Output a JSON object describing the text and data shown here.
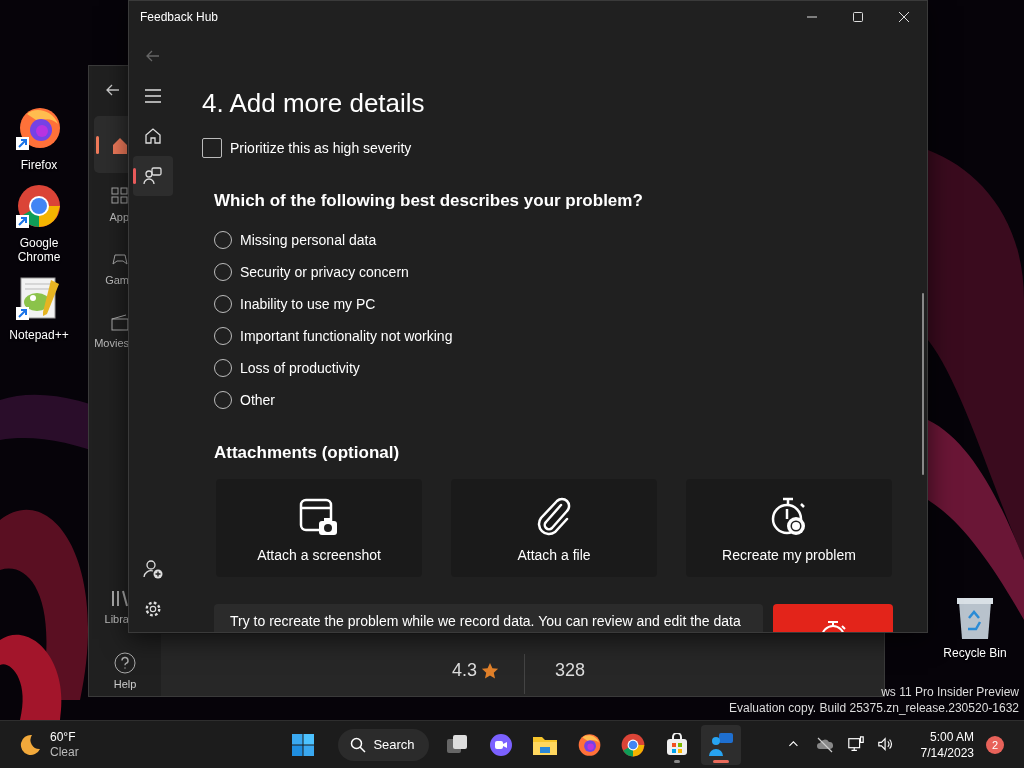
{
  "desktop_icons": [
    {
      "kind": "firefox",
      "label": "Firefox"
    },
    {
      "kind": "chrome",
      "label": "Google Chrome"
    },
    {
      "kind": "notepad",
      "label": "Notepad++"
    }
  ],
  "recycle_bin": {
    "label": "Recycle Bin"
  },
  "store_window": {
    "nav": [
      {
        "kind": "home",
        "selected": true
      },
      {
        "kind": "apps",
        "label": "App",
        "selected": false
      },
      {
        "kind": "games",
        "label": "Gam",
        "selected": false
      },
      {
        "kind": "movies",
        "label": "Movies",
        "selected": false
      },
      {
        "kind": "library",
        "label": "Libra",
        "selected": false
      }
    ],
    "help": {
      "label": "Help"
    },
    "rating": "4.3",
    "ratings_count": "328"
  },
  "feedback_window": {
    "title": "Feedback Hub",
    "nav": [
      {
        "kind": "home",
        "selected": false
      },
      {
        "kind": "feedback",
        "selected": true
      }
    ],
    "heading": "4. Add more details",
    "severity": {
      "label": "Prioritize this as high severity",
      "checked": false
    },
    "question": "Which of the following best describes your problem?",
    "options": [
      {
        "label": "Missing personal data",
        "selected": false
      },
      {
        "label": "Security or privacy concern",
        "selected": false
      },
      {
        "label": "Inability to use my PC",
        "selected": false
      },
      {
        "label": "Important functionality not working",
        "selected": false
      },
      {
        "label": "Loss of productivity",
        "selected": false
      },
      {
        "label": "Other",
        "selected": false
      }
    ],
    "attachments_heading": "Attachments (optional)",
    "attachments": [
      {
        "kind": "screenshot",
        "label": "Attach a screenshot"
      },
      {
        "kind": "file",
        "label": "Attach a file"
      },
      {
        "kind": "recreate",
        "label": "Recreate my problem"
      }
    ],
    "recreate_hint": "Try to recreate the problem while we record data. You can review and edit the data"
  },
  "watermark": [
    "ws 11 Pro Insider Preview",
    "Evaluation copy. Build 25375.zn_release.230520-1632"
  ],
  "taskbar": {
    "weather": {
      "temperature": "60°F",
      "condition": "Clear"
    },
    "search": {
      "label": "Search"
    },
    "apps": [
      {
        "kind": "task-view",
        "running": false,
        "selected": false
      },
      {
        "kind": "chat",
        "running": false,
        "selected": false
      },
      {
        "kind": "explorer",
        "running": false,
        "selected": false
      },
      {
        "kind": "firefox",
        "running": false,
        "selected": false
      },
      {
        "kind": "chrome",
        "running": false,
        "selected": false
      },
      {
        "kind": "store",
        "running": true,
        "selected": false
      },
      {
        "kind": "feedback",
        "running": true,
        "selected": true
      }
    ],
    "clock": {
      "time": "5:00 AM",
      "date": "7/14/2023"
    },
    "notification_count": "2"
  }
}
